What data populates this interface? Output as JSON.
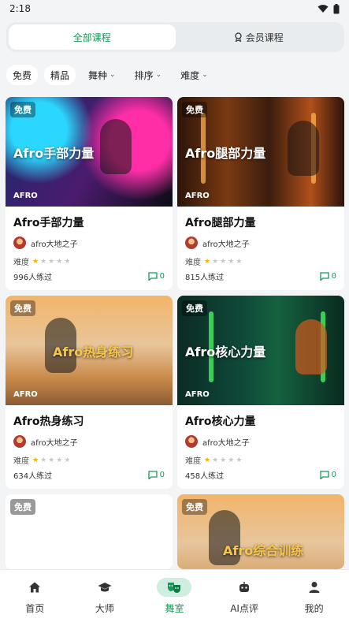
{
  "status": {
    "time": "2:18"
  },
  "segments": [
    {
      "label": "全部课程",
      "icon": ""
    },
    {
      "label": "会员课程",
      "icon": "member-badge-icon"
    }
  ],
  "filters": [
    {
      "label": "免费",
      "style": "pill"
    },
    {
      "label": "精品",
      "style": "pill"
    },
    {
      "label": "舞种",
      "style": "dropdown"
    },
    {
      "label": "排序",
      "style": "dropdown"
    },
    {
      "label": "难度",
      "style": "dropdown"
    }
  ],
  "cards": [
    {
      "badge": "免费",
      "thumb_title": "Afro手部力量",
      "thumb_tag": "AFRO",
      "title": "Afro手部力量",
      "author": "afro大地之子",
      "difficulty_label": "难度",
      "difficulty_rating": 1,
      "difficulty_max": 5,
      "practiced": "996人练过",
      "comments": "0",
      "theme": "bg1"
    },
    {
      "badge": "免费",
      "thumb_title": "Afro腿部力量",
      "thumb_tag": "AFRO",
      "title": "Afro腿部力量",
      "author": "afro大地之子",
      "difficulty_label": "难度",
      "difficulty_rating": 1,
      "difficulty_max": 5,
      "practiced": "815人练过",
      "comments": "0",
      "theme": "bg2"
    },
    {
      "badge": "免费",
      "thumb_title": "Afro热身练习",
      "thumb_tag": "AFRO",
      "title": "Afro热身练习",
      "author": "afro大地之子",
      "difficulty_label": "难度",
      "difficulty_rating": 1,
      "difficulty_max": 5,
      "practiced": "634人练过",
      "comments": "0",
      "theme": "bg3"
    },
    {
      "badge": "免费",
      "thumb_title": "Afro核心力量",
      "thumb_tag": "AFRO",
      "title": "Afro核心力量",
      "author": "afro大地之子",
      "difficulty_label": "难度",
      "difficulty_rating": 1,
      "difficulty_max": 5,
      "practiced": "458人练过",
      "comments": "0",
      "theme": "bg4"
    },
    {
      "badge": "免费",
      "thumb_title": "",
      "thumb_tag": "",
      "theme": "bg5"
    },
    {
      "badge": "免费",
      "thumb_title": "Afro综合训练",
      "thumb_tag": "",
      "theme": "bg6"
    }
  ],
  "tabbar": [
    {
      "label": "首页",
      "icon": "home-icon",
      "active": false
    },
    {
      "label": "大师",
      "icon": "graduation-cap-icon",
      "active": false
    },
    {
      "label": "舞室",
      "icon": "masks-icon",
      "active": true
    },
    {
      "label": "AI点评",
      "icon": "robot-icon",
      "active": false
    },
    {
      "label": "我的",
      "icon": "user-icon",
      "active": false
    }
  ],
  "colors": {
    "accent": "#159a57",
    "star": "#f4b400"
  }
}
